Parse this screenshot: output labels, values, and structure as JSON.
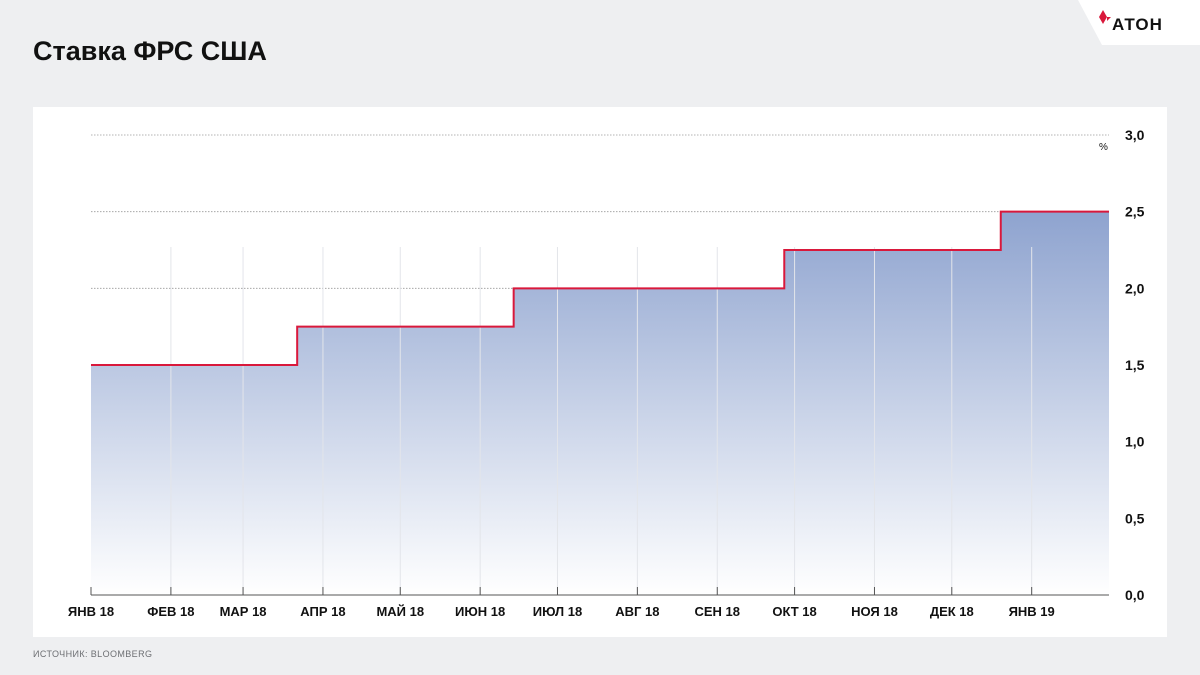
{
  "title": "Ставка ФРС США",
  "logo": {
    "text": "АТОН",
    "icon": "aton-logo-icon",
    "accent": "#d9183b"
  },
  "source": "ИСТОЧНИК:  BLOOMBERG",
  "colors": {
    "line": "#d9183b",
    "area_top": "#8ea3cf",
    "area_bottom": "#ffffff",
    "grid": "#9a9a9a",
    "axis": "#555555",
    "text": "#111111"
  },
  "chart_data": {
    "type": "line",
    "step": true,
    "unit": "%",
    "ylim": [
      0,
      3
    ],
    "y_ticks": [
      "0,0",
      "0,5",
      "1,0",
      "1,5",
      "2,0",
      "2,5",
      "3,0"
    ],
    "y_tick_values": [
      0,
      0.5,
      1.0,
      1.5,
      2.0,
      2.5,
      3.0
    ],
    "x_ticks": [
      "ЯНВ 18",
      "ФЕВ 18",
      "МАР 18",
      "АПР 18",
      "МАЙ 18",
      "ИЮН 18",
      "ИЮЛ 18",
      "АВГ 18",
      "СЕН 18",
      "ОКТ 18",
      "НОЯ 18",
      "ДЕК 18",
      "ЯНВ 19"
    ],
    "x_tick_dates": [
      "2018-01-01",
      "2018-02-01",
      "2018-03-01",
      "2018-04-01",
      "2018-05-01",
      "2018-06-01",
      "2018-07-01",
      "2018-08-01",
      "2018-09-01",
      "2018-10-01",
      "2018-11-01",
      "2018-12-01",
      "2019-01-01"
    ],
    "x_range": [
      "2018-01-01",
      "2019-01-31"
    ],
    "grid": true,
    "legend": false,
    "series": [
      {
        "points": [
          {
            "x": "2018-01-01",
            "y": 1.5
          },
          {
            "x": "2018-03-22",
            "y": 1.75
          },
          {
            "x": "2018-06-14",
            "y": 2.0
          },
          {
            "x": "2018-09-27",
            "y": 2.25
          },
          {
            "x": "2018-12-20",
            "y": 2.5
          },
          {
            "x": "2019-01-31",
            "y": 2.5
          }
        ]
      }
    ]
  }
}
